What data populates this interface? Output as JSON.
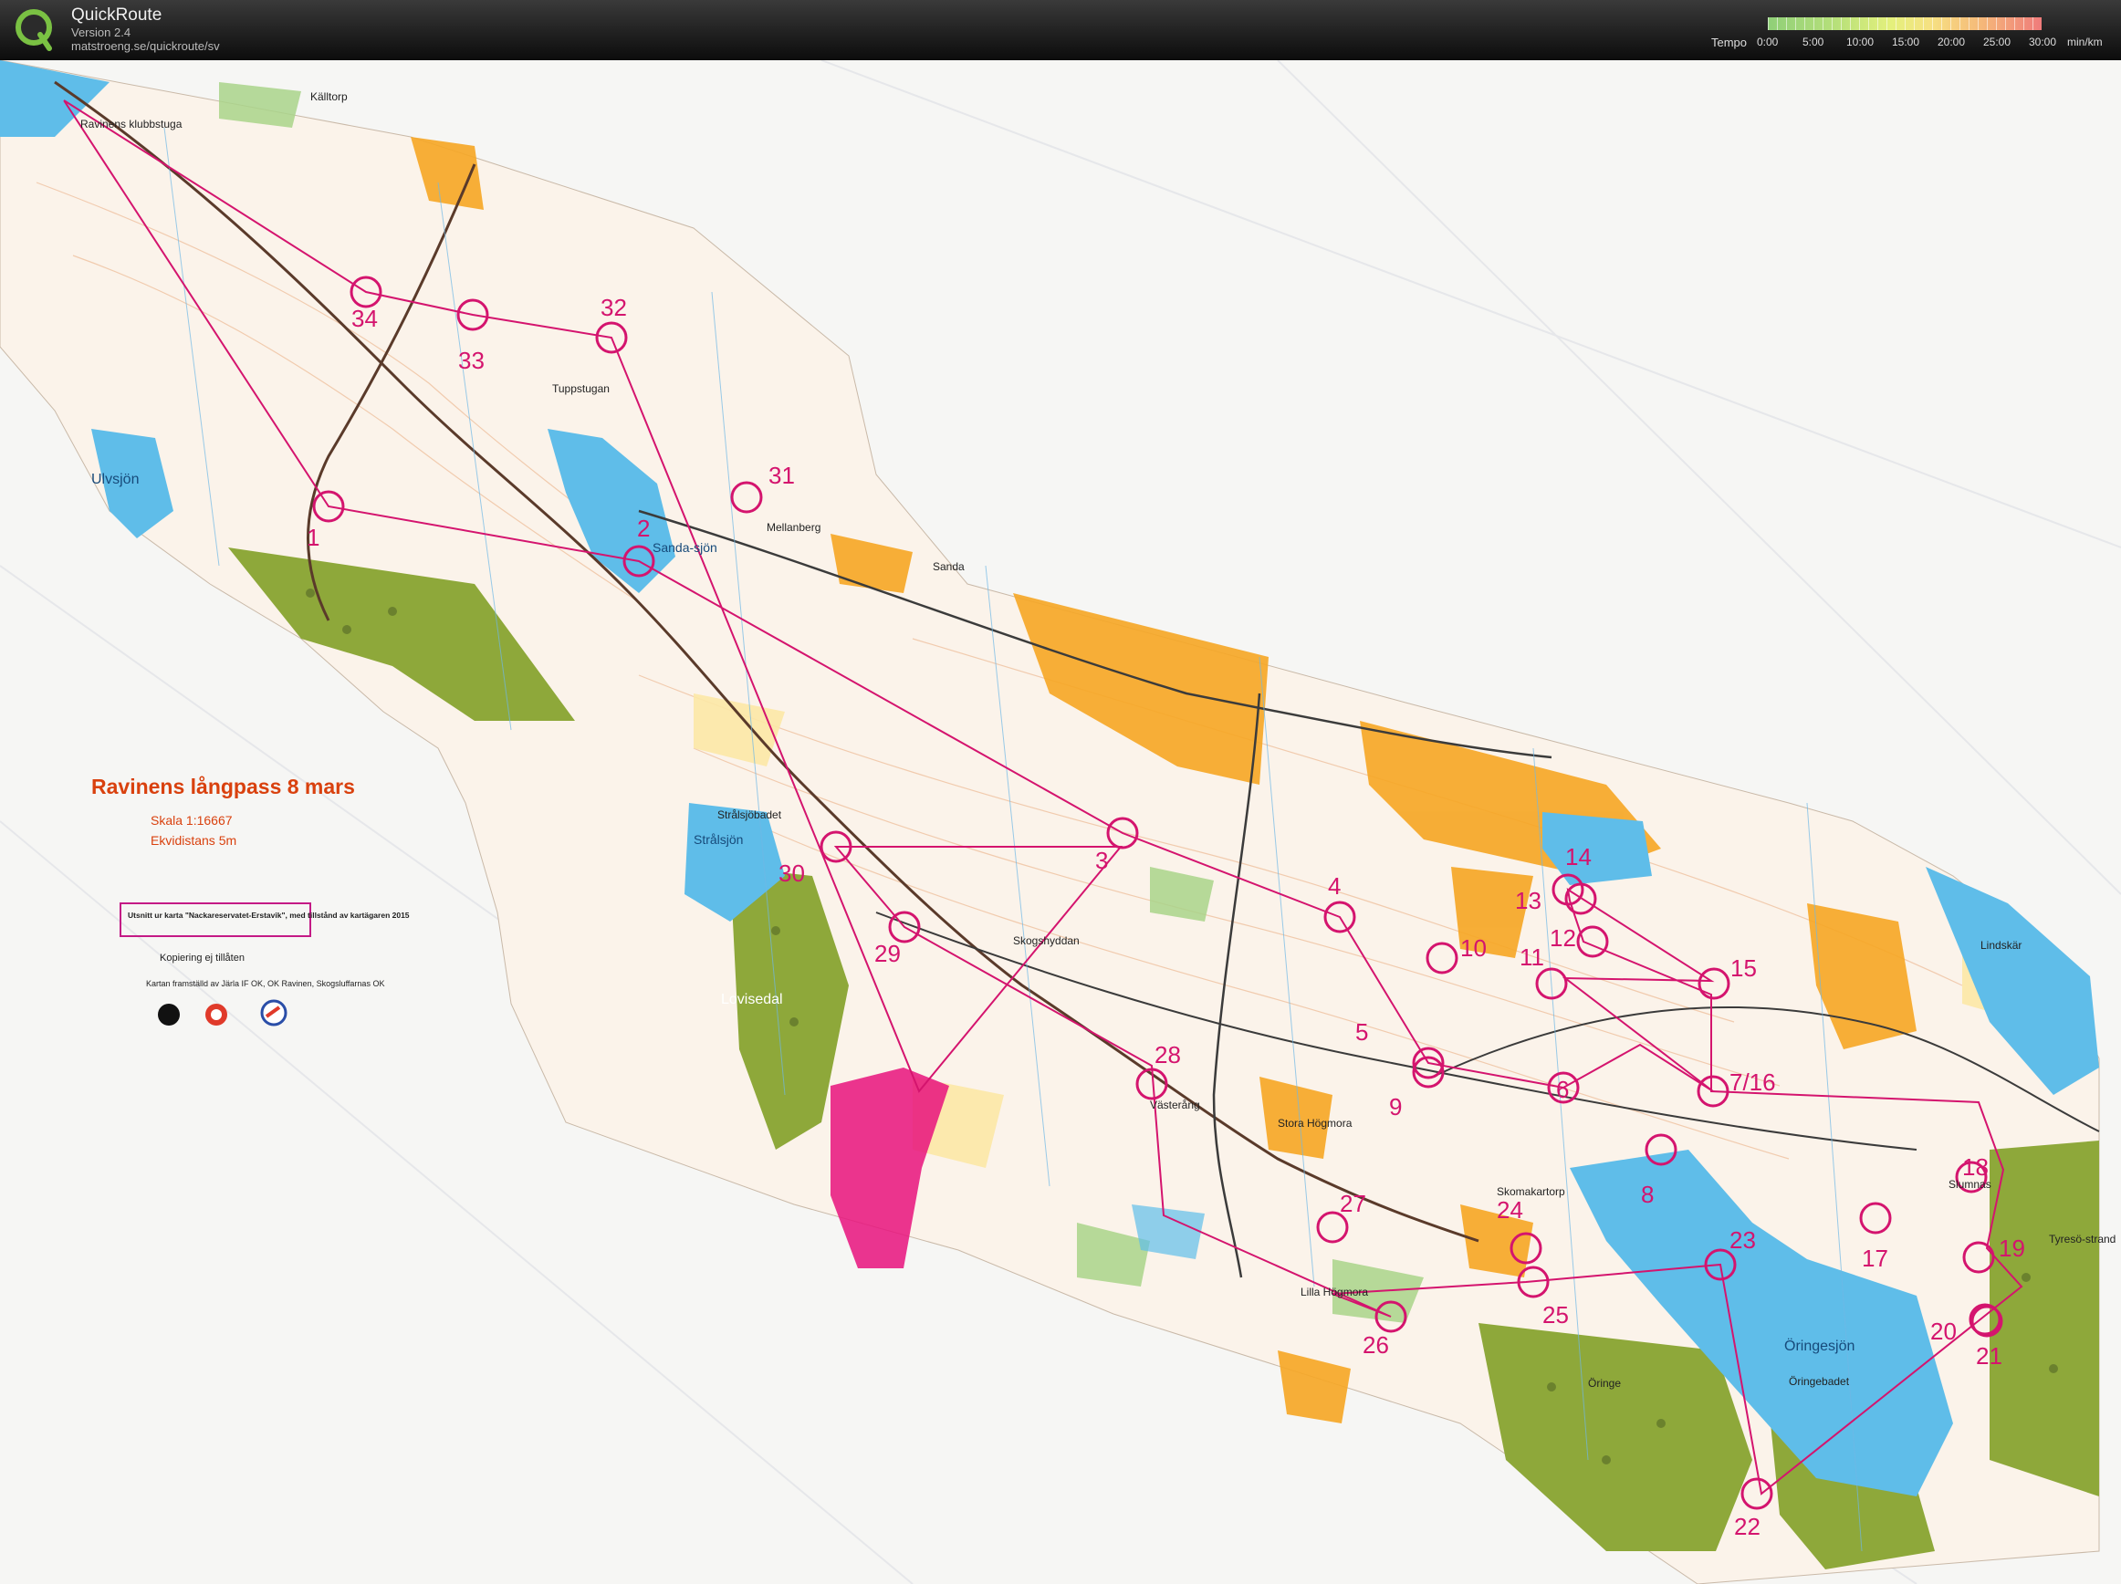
{
  "app": {
    "name": "QuickRoute",
    "version": "Version 2.4",
    "url": "matstroeng.se/quickroute/sv"
  },
  "tempo": {
    "title": "Tempo",
    "ticks": [
      "0:00",
      "5:00",
      "10:00",
      "15:00",
      "20:00",
      "25:00",
      "30:00"
    ],
    "unit": "min/km"
  },
  "map": {
    "title": "Ravinens långpass 8 mars",
    "scale": "Skala 1:16667",
    "contour": "Ekvidistans 5m",
    "excerpt_note": "Utsnitt ur karta \"Nackareservatet-Erstavik\", med tillstånd av kartägaren 2015",
    "copy_note": "Kopiering ej tillåten",
    "credits": "Kartan framställd av Järla IF OK, OK Ravinen, Skogsluffarnas OK",
    "places": [
      "Ravinens klubbstuga",
      "Källtorp",
      "Ulvsjön",
      "Tuppstugan",
      "Sanda-sjön",
      "Mellanberg",
      "Sanda",
      "Strålsjöbadet",
      "Strålsjön",
      "Skogshyddan",
      "Lovisedal",
      "Västerång",
      "Stora Högmora",
      "Skomakartorp",
      "Lilla Högmora",
      "Öringesjön",
      "Öringebadet",
      "Öringe",
      "Lindskär",
      "Slumnas",
      "Tyresö-strand"
    ],
    "controls": [
      "1",
      "2",
      "3",
      "4",
      "5",
      "6",
      "7/16",
      "8",
      "9",
      "10",
      "11",
      "12",
      "13",
      "14",
      "15",
      "17",
      "18",
      "19",
      "20",
      "21",
      "22",
      "23",
      "24",
      "25",
      "26",
      "27",
      "28",
      "29",
      "30",
      "31",
      "32",
      "33",
      "34"
    ],
    "colors": {
      "course": "#d4146e",
      "water": "#5fbde9",
      "open": "#f6a623",
      "urban": "#8ea83a",
      "paper": "#f6f6f4"
    }
  }
}
